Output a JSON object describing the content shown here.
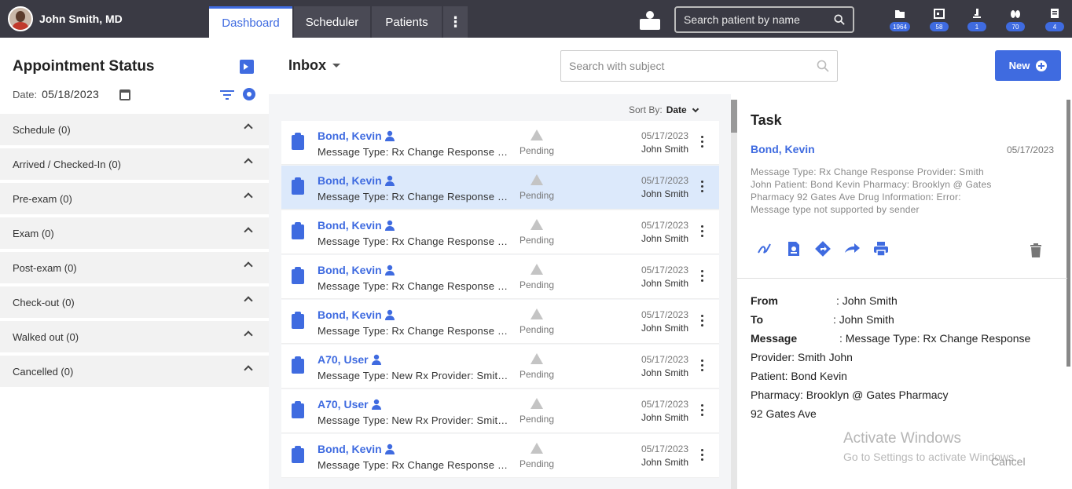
{
  "header": {
    "user_name": "John Smith, MD",
    "tabs": [
      {
        "label": "Dashboard",
        "active": true
      },
      {
        "label": "Scheduler",
        "active": false
      },
      {
        "label": "Patients",
        "active": false
      }
    ],
    "more_label": "⋮",
    "search_placeholder": "Search patient by name",
    "notifications": [
      {
        "icon": "folder-icon",
        "count": "1964"
      },
      {
        "icon": "calendar-icon",
        "count": "58"
      },
      {
        "icon": "microscope-icon",
        "count": "1"
      },
      {
        "icon": "pills-icon",
        "count": "70"
      },
      {
        "icon": "document-icon",
        "count": "4"
      }
    ]
  },
  "sidebar": {
    "title": "Appointment Status",
    "date_label": "Date:",
    "date_value": "05/18/2023",
    "statuses": [
      {
        "label": "Schedule (0)"
      },
      {
        "label": "Arrived / Checked-In (0)"
      },
      {
        "label": "Pre-exam (0)"
      },
      {
        "label": "Exam (0)"
      },
      {
        "label": "Post-exam (0)"
      },
      {
        "label": "Check-out (0)"
      },
      {
        "label": "Walked out (0)"
      },
      {
        "label": "Cancelled (0)"
      }
    ]
  },
  "inbox": {
    "title": "Inbox",
    "search_placeholder": "Search with subject",
    "new_label": "New",
    "sort_label": "Sort By:",
    "sort_value": "Date",
    "messages": [
      {
        "name": "Bond, Kevin",
        "subject": "Message Type: Rx Change Response Provider",
        "status": "Pending",
        "date": "05/17/2023",
        "by": "John Smith",
        "selected": false
      },
      {
        "name": "Bond, Kevin",
        "subject": "Message Type: Rx Change Response Provider",
        "status": "Pending",
        "date": "05/17/2023",
        "by": "John Smith",
        "selected": true
      },
      {
        "name": "Bond, Kevin",
        "subject": "Message Type: Rx Change Response Provider",
        "status": "Pending",
        "date": "05/17/2023",
        "by": "John Smith",
        "selected": false
      },
      {
        "name": "Bond, Kevin",
        "subject": "Message Type: Rx Change Response Provider",
        "status": "Pending",
        "date": "05/17/2023",
        "by": "John Smith",
        "selected": false
      },
      {
        "name": "Bond, Kevin",
        "subject": "Message Type: Rx Change Response Provider",
        "status": "Pending",
        "date": "05/17/2023",
        "by": "John Smith",
        "selected": false
      },
      {
        "name": "A70, User",
        "subject": "Message Type: New Rx Provider: Smith John",
        "status": "Pending",
        "date": "05/17/2023",
        "by": "John Smith",
        "selected": false
      },
      {
        "name": "A70, User",
        "subject": "Message Type: New Rx Provider: Smith John",
        "status": "Pending",
        "date": "05/17/2023",
        "by": "John Smith",
        "selected": false
      },
      {
        "name": "Bond, Kevin",
        "subject": "Message Type: Rx Change Response Provider",
        "status": "Pending",
        "date": "05/17/2023",
        "by": "John Smith",
        "selected": false
      }
    ]
  },
  "task": {
    "title": "Task",
    "patient_name": "Bond, Kevin",
    "date": "05/17/2023",
    "description": "Message Type: Rx Change Response Provider: Smith John Patient: Bond Kevin Pharmacy: Brooklyn @ Gates Pharmacy 92 Gates Ave Drug Information: Error: Message type not supported by sender",
    "from_label": "From",
    "from_value": ": John Smith",
    "to_label": "To",
    "to_value": ": John Smith",
    "message_label": "Message",
    "message_value": ": Message Type: Rx Change Response",
    "message_lines": [
      "Provider: Smith John",
      "Patient: Bond Kevin",
      "Pharmacy: Brooklyn @ Gates Pharmacy",
      "92 Gates Ave"
    ],
    "cancel_label": "Cancel"
  },
  "watermark": {
    "line1": "Activate Windows",
    "line2": "Go to Settings to activate Windows."
  },
  "colors": {
    "accent": "#3f6be0",
    "topbar": "#3a3a44",
    "selected_row": "#dce9fb"
  }
}
